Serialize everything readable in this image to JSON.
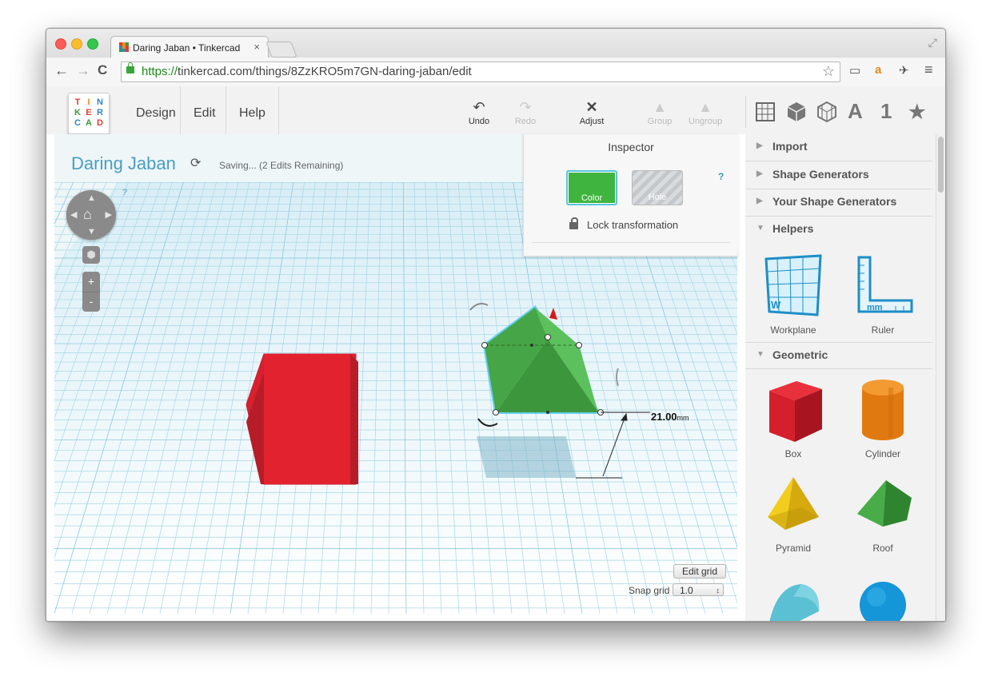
{
  "browser": {
    "tab_title": "Daring Jaban • Tinkercad",
    "tab_close": "×",
    "url_scheme": "https://",
    "url_rest": "tinkercad.com/things/8ZzKRO5m7GN-daring-jaban/edit",
    "back": "←",
    "forward": "→",
    "reload": "C",
    "star": "☆",
    "menu": "≡"
  },
  "app": {
    "logo_letters": [
      "T",
      "I",
      "N",
      "K",
      "E",
      "R",
      "C",
      "A",
      "D"
    ],
    "menu": [
      "Design",
      "Edit",
      "Help"
    ],
    "tools": [
      {
        "label": "Undo",
        "icon": "undo-icon",
        "glyph": "↶"
      },
      {
        "label": "Redo",
        "icon": "redo-icon",
        "glyph": "↷"
      },
      {
        "label": "Adjust",
        "icon": "adjust-icon",
        "glyph": "✕"
      },
      {
        "label": "Group",
        "icon": "group-icon",
        "glyph": "▲"
      },
      {
        "label": "Ungroup",
        "icon": "ungroup-icon",
        "glyph": "▲"
      }
    ],
    "view_icons": [
      "grid-view-icon",
      "box-view-icon",
      "wire-view-icon",
      "A",
      "1",
      "★"
    ]
  },
  "workspace": {
    "title": "Daring Jaban",
    "saving": "Saving... (2 Edits Remaining)",
    "refresh": "⟳",
    "help": "?",
    "dimension": "21.00",
    "dimension_unit": "mm",
    "edit_grid": "Edit grid",
    "snap_label": "Snap grid",
    "snap_value": "1.0",
    "zoom_in": "+",
    "zoom_out": "-"
  },
  "inspector": {
    "title": "Inspector",
    "color_label": "Color",
    "hole_label": "Hole",
    "help": "?",
    "lock_label": "Lock transformation"
  },
  "sidebar": {
    "sections": [
      "Import",
      "Shape Generators",
      "Your Shape Generators",
      "Helpers",
      "Geometric"
    ],
    "helpers": [
      "Workplane",
      "Ruler"
    ],
    "shapes": [
      "Box",
      "Cylinder",
      "Pyramid",
      "Roof"
    ],
    "workplane_mark": "W",
    "ruler_mark": "mm"
  },
  "colors": {
    "accent": "#4a9dc3",
    "box_red": "#d9202e",
    "roof_green": "#3a9a3a",
    "grid_line": "#9fcfe0"
  }
}
